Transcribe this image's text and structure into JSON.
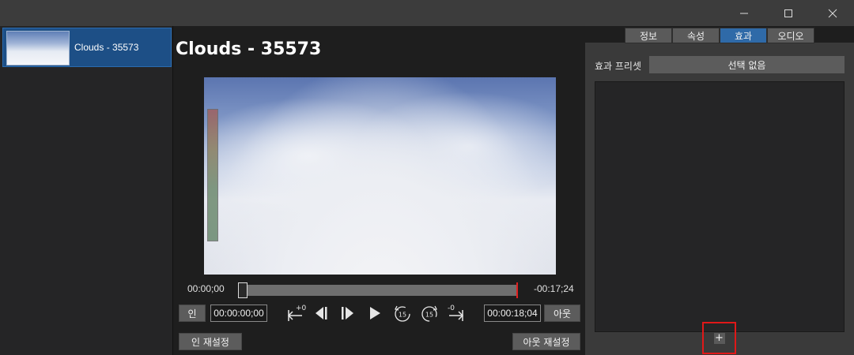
{
  "window": {
    "minimize_icon": "minimize-icon",
    "maximize_icon": "maximize-icon",
    "close_icon": "close-icon"
  },
  "clips": [
    {
      "label": "Clouds - 35573"
    }
  ],
  "viewer": {
    "title": "Clouds - 35573",
    "current_time": "00:00;00",
    "remaining_time": "-00:17;24",
    "position_fraction": 0.0,
    "in_button": "인",
    "in_timecode": "00:00:00;00",
    "out_timecode": "00:00:18;04",
    "out_button": "아웃",
    "reset_in": "인 재설정",
    "reset_out": "아웃 재설정",
    "transport": [
      {
        "name": "go-to-in-icon",
        "label": "+0"
      },
      {
        "name": "step-back-icon",
        "label": ""
      },
      {
        "name": "step-forward-icon",
        "label": ""
      },
      {
        "name": "play-icon",
        "label": ""
      },
      {
        "name": "rewind-15-icon",
        "label": "15"
      },
      {
        "name": "forward-15-icon",
        "label": "15"
      },
      {
        "name": "go-to-out-icon",
        "label": "-0"
      }
    ]
  },
  "inspector": {
    "tabs": [
      {
        "label": "정보",
        "active": false
      },
      {
        "label": "속성",
        "active": false
      },
      {
        "label": "효과",
        "active": true
      },
      {
        "label": "오디오",
        "active": false
      }
    ],
    "preset_label": "효과 프리셋",
    "preset_value": "선택 없음",
    "add_icon": "+",
    "accent_color": "#2f6aa8"
  }
}
